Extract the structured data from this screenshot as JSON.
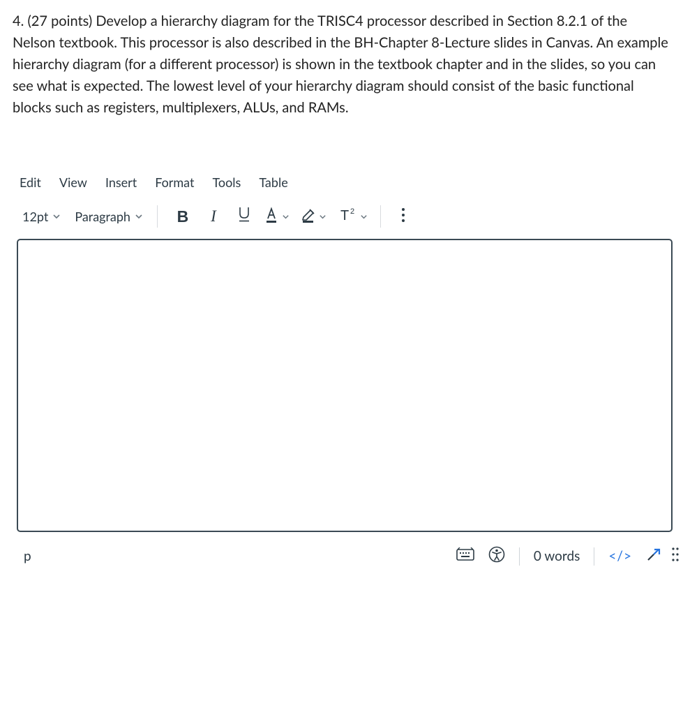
{
  "question": {
    "text": "4. (27 points) Develop a hierarchy diagram for the TRISC4 processor described in Section 8.2.1 of the Nelson textbook.  This processor is also described in the BH-Chapter 8-Lecture slides in Canvas.  An example hierarchy diagram (for a different processor) is shown in the textbook chapter and in the slides, so you can see what is expected.  The lowest level of your hierarchy diagram should consist of the basic functional blocks such as registers, multiplexers, ALUs, and RAMs."
  },
  "menubar": {
    "edit": "Edit",
    "view": "View",
    "insert": "Insert",
    "format": "Format",
    "tools": "Tools",
    "table": "Table"
  },
  "toolbar": {
    "font_size": "12pt",
    "block_format": "Paragraph",
    "bold": "B",
    "italic": "I"
  },
  "statusbar": {
    "path": "p",
    "word_count": "0 words",
    "html_view": "</>"
  }
}
